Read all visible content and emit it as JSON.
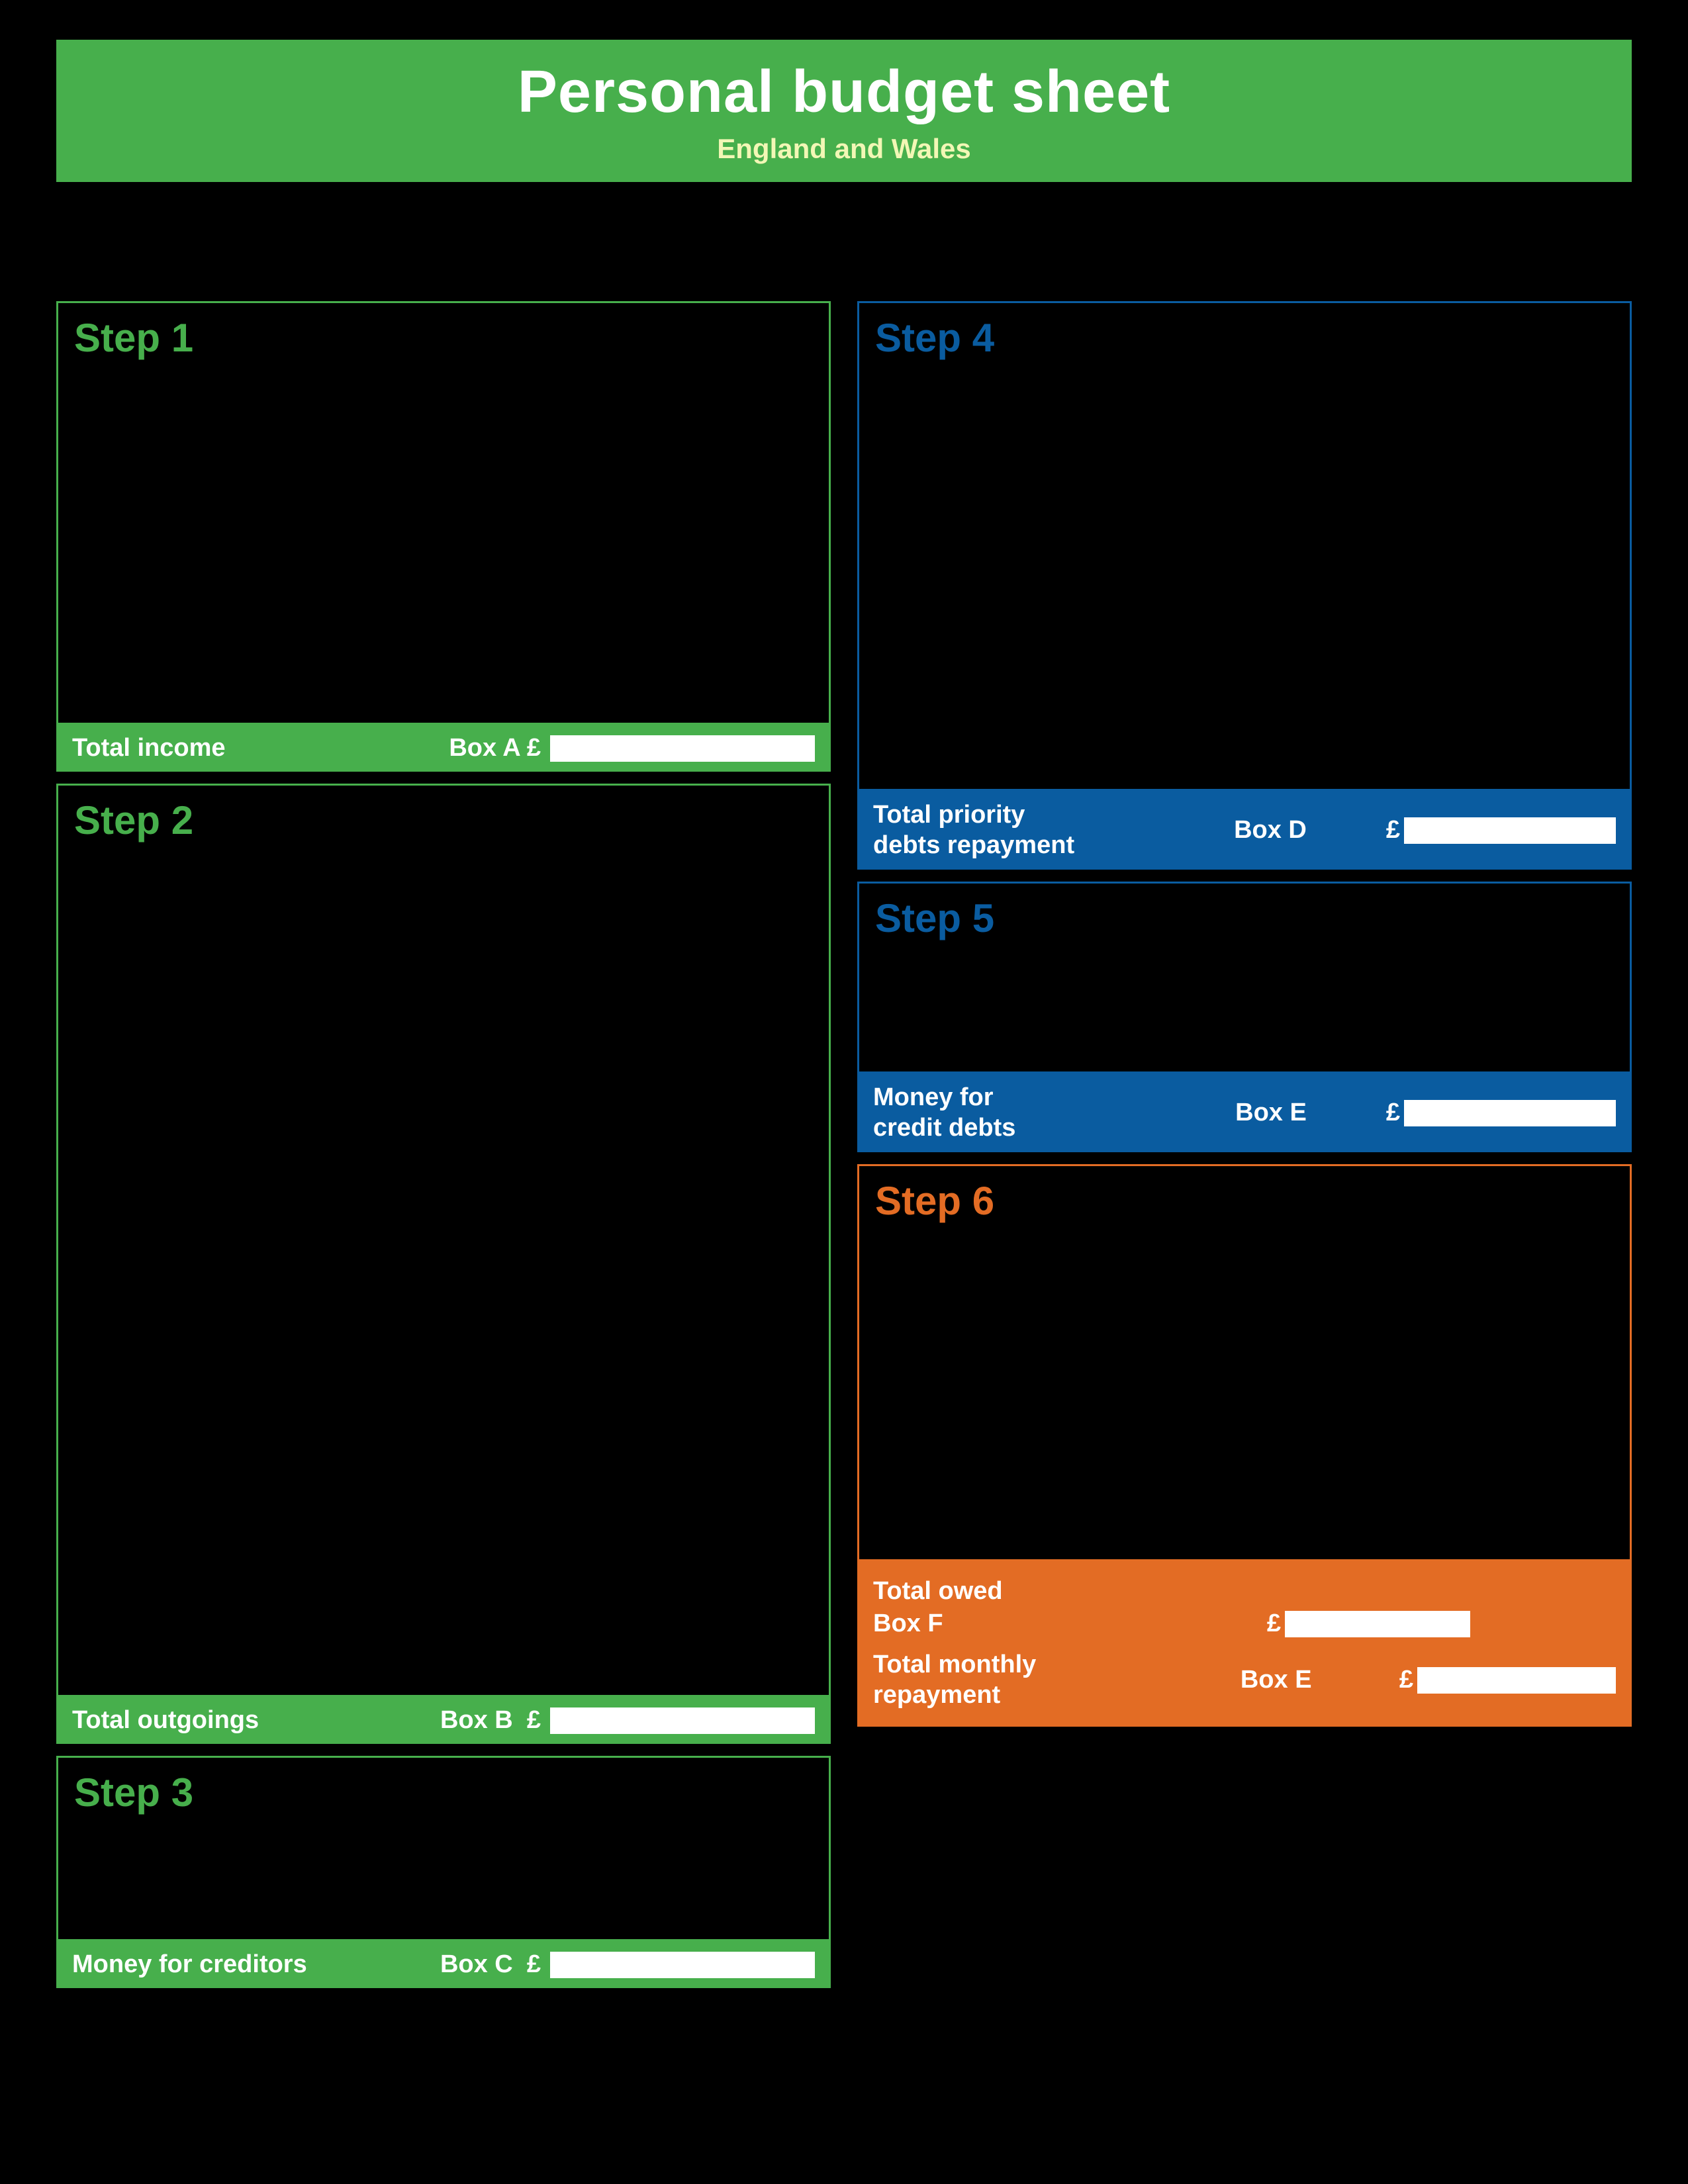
{
  "header": {
    "title": "Personal budget sheet",
    "subtitle": "England and Wales"
  },
  "step1": {
    "title": "Step 1",
    "footer_label": "Total income",
    "box": "Box A",
    "currency": "£"
  },
  "step2": {
    "title": "Step 2",
    "footer_label": "Total outgoings",
    "box": "Box B",
    "currency": "£"
  },
  "step3": {
    "title": "Step 3",
    "footer_label": "Money for creditors",
    "box": "Box C",
    "currency": "£"
  },
  "step4": {
    "title": "Step 4",
    "footer_label": "Total priority\ndebts repayment",
    "box": "Box D",
    "currency": "£"
  },
  "step5": {
    "title": "Step 5",
    "footer_label": "Money for\ncredit debts",
    "box": "Box E",
    "currency": "£"
  },
  "step6": {
    "title": "Step 6",
    "total_owed_label": "Total owed",
    "box_f": "Box F",
    "total_repay_label": "Total monthly\nrepayment",
    "box_e": "Box E",
    "currency": "£"
  }
}
